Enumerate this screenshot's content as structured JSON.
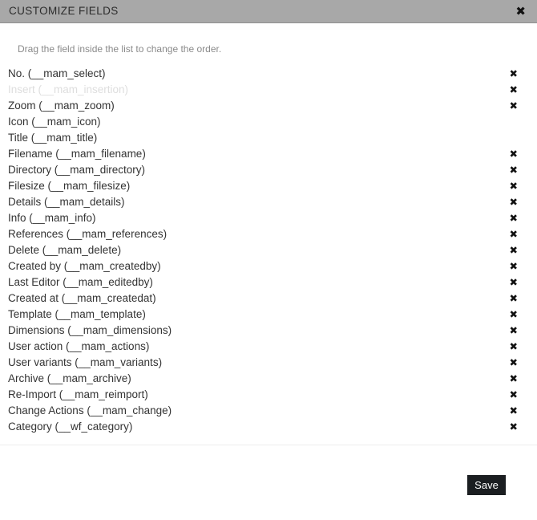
{
  "dialog": {
    "title": "CUSTOMIZE FIELDS",
    "close_icon": "close-icon",
    "hint": "Drag the field inside the list to change the order."
  },
  "fields": [
    {
      "label": "No. (__mam_select)",
      "removable": true,
      "disabled": false
    },
    {
      "label": "Insert (__mam_insertion)",
      "removable": true,
      "disabled": true
    },
    {
      "label": "Zoom (__mam_zoom)",
      "removable": true,
      "disabled": false
    },
    {
      "label": "Icon (__mam_icon)",
      "removable": false,
      "disabled": false
    },
    {
      "label": "Title (__mam_title)",
      "removable": false,
      "disabled": false
    },
    {
      "label": "Filename (__mam_filename)",
      "removable": true,
      "disabled": false
    },
    {
      "label": "Directory (__mam_directory)",
      "removable": true,
      "disabled": false
    },
    {
      "label": "Filesize (__mam_filesize)",
      "removable": true,
      "disabled": false
    },
    {
      "label": "Details (__mam_details)",
      "removable": true,
      "disabled": false
    },
    {
      "label": "Info (__mam_info)",
      "removable": true,
      "disabled": false
    },
    {
      "label": "References (__mam_references)",
      "removable": true,
      "disabled": false
    },
    {
      "label": "Delete (__mam_delete)",
      "removable": true,
      "disabled": false
    },
    {
      "label": "Created by (__mam_createdby)",
      "removable": true,
      "disabled": false
    },
    {
      "label": "Last Editor (__mam_editedby)",
      "removable": true,
      "disabled": false
    },
    {
      "label": "Created at (__mam_createdat)",
      "removable": true,
      "disabled": false
    },
    {
      "label": "Template (__mam_template)",
      "removable": true,
      "disabled": false
    },
    {
      "label": "Dimensions (__mam_dimensions)",
      "removable": true,
      "disabled": false
    },
    {
      "label": "User action (__mam_actions)",
      "removable": true,
      "disabled": false
    },
    {
      "label": "User variants (__mam_variants)",
      "removable": true,
      "disabled": false
    },
    {
      "label": "Archive (__mam_archive)",
      "removable": true,
      "disabled": false
    },
    {
      "label": "Re-Import (__mam_reimport)",
      "removable": true,
      "disabled": false
    },
    {
      "label": "Change Actions (__mam_change)",
      "removable": true,
      "disabled": false
    },
    {
      "label": "Category (__wf_category)",
      "removable": true,
      "disabled": false
    }
  ],
  "row_remove_icon": "✖",
  "footer": {
    "save_label": "Save"
  },
  "colors": {
    "titlebar_bg": "#a8a8a8",
    "title_text": "#2c2c2c",
    "hint_text": "#8a8a8a",
    "row_text": "#333333",
    "row_text_disabled": "#dedede",
    "save_bg": "#1b1e21",
    "save_text": "#ffffff",
    "divider": "#eeeeee"
  }
}
